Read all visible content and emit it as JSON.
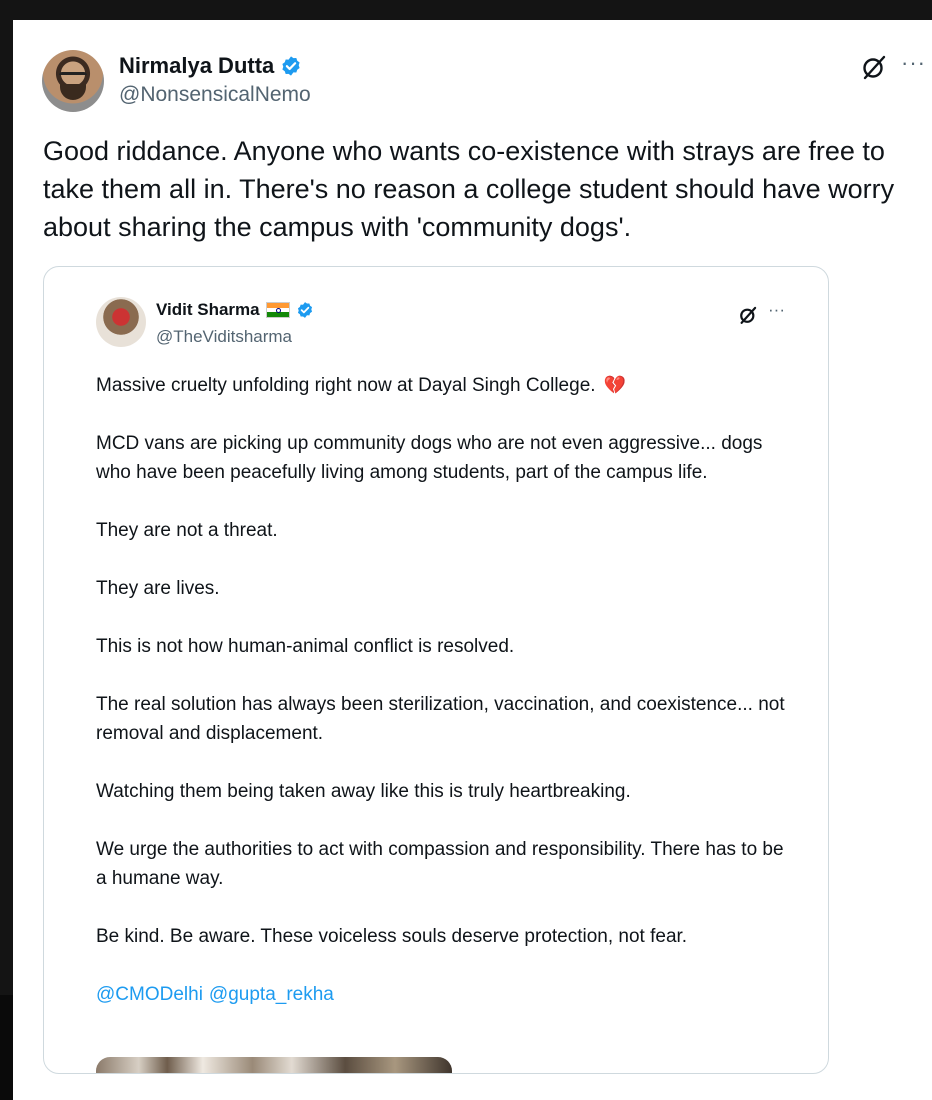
{
  "tweet": {
    "author_name": "Nirmalya Dutta",
    "author_handle": "@NonsensicalNemo",
    "text": "Good riddance. Anyone who wants co-existence with strays are free to take them all in. There's no reason a college student should have worry about sharing the campus with 'community dogs'.",
    "more_label": "···",
    "verified_icon": "verified-badge-icon",
    "grok_icon": "grok-icon"
  },
  "quote": {
    "author_name": "Vidit Sharma",
    "flag": "india-flag-icon",
    "author_handle": "@TheViditsharma",
    "more_label": "···",
    "paragraphs": [
      "Massive cruelty unfolding right now at Dayal Singh College.",
      "MCD vans are picking up community dogs who are not even aggressive... dogs who have been peacefully living among students, part of the campus life.",
      "They are not a threat.",
      "They are lives.",
      "This is not how human-animal conflict is resolved.",
      "The real solution has always been  sterilization, vaccination, and coexistence... not removal and displacement.",
      "Watching them being taken away like this is truly heartbreaking.",
      "We urge the authorities to act with compassion and responsibility. There has to be a humane way.",
      "Be kind. Be aware. These voiceless souls deserve protection, not fear."
    ],
    "emoji": "💔",
    "mentions": [
      "@CMODelhi",
      "@gupta_rekha"
    ]
  },
  "colors": {
    "text": "#0f1419",
    "secondary": "#536471",
    "link": "#1d9bf0",
    "verified": "#1d9bf0",
    "border": "#cfd9de"
  }
}
